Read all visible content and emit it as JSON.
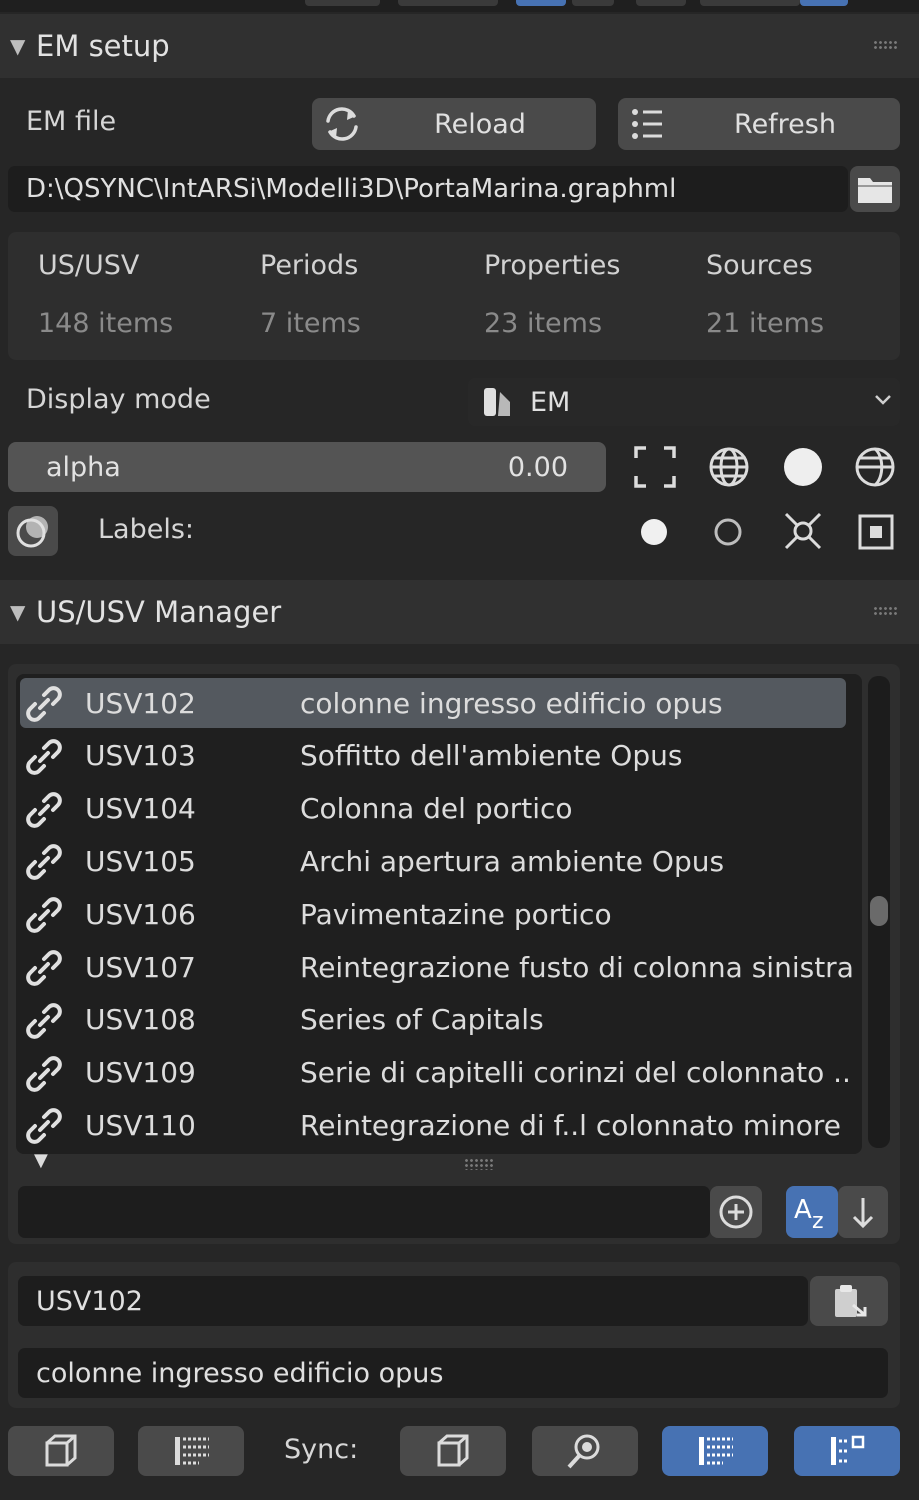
{
  "em_setup": {
    "title": "EM setup",
    "em_file_label": "EM file",
    "reload_label": "Reload",
    "refresh_label": "Refresh",
    "file_path": "D:\\QSYNC\\IntARSi\\Modelli3D\\PortaMarina.graphml",
    "stats": [
      {
        "label": "US/USV",
        "value": "148 items"
      },
      {
        "label": "Periods",
        "value": "7 items"
      },
      {
        "label": "Properties",
        "value": "23 items"
      },
      {
        "label": "Sources",
        "value": "21 items"
      }
    ],
    "display_mode_label": "Display mode",
    "display_mode_value": "EM",
    "alpha_label": "alpha",
    "alpha_value": "0.00",
    "labels_label": "Labels:"
  },
  "manager": {
    "title": "US/USV Manager",
    "rows": [
      {
        "code": "USV102",
        "desc": "colonne ingresso edificio opus",
        "selected": true
      },
      {
        "code": "USV103",
        "desc": "Soffitto dell'ambiente Opus"
      },
      {
        "code": "USV104",
        "desc": "Colonna del portico"
      },
      {
        "code": "USV105",
        "desc": "Archi apertura ambiente Opus"
      },
      {
        "code": "USV106",
        "desc": "Pavimentazine portico"
      },
      {
        "code": "USV107",
        "desc": "Reintegrazione fusto di colonna sinistra"
      },
      {
        "code": "USV108",
        "desc": "Series of Capitals"
      },
      {
        "code": "USV109",
        "desc": "Serie di capitelli corinzi del colonnato .."
      },
      {
        "code": "USV110",
        "desc": "Reintegrazione di f..l colonnato minore"
      }
    ],
    "filter_value": "",
    "selected_code": "USV102",
    "selected_desc": "colonne ingresso edificio opus",
    "sync_label": "Sync:"
  },
  "colors": {
    "accent": "#4772b3",
    "panel_bg": "#262626",
    "header_bg": "#303030",
    "button": "#4a4a4a"
  }
}
